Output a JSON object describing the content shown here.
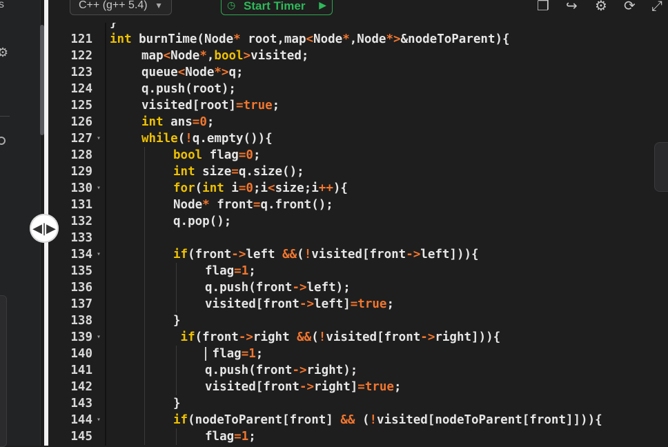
{
  "toolbar": {
    "language": "C++ (g++ 5.4)",
    "timer_label": "Start Timer",
    "left_tab_text": "s"
  },
  "colors": {
    "keyword": "#eec100",
    "operator": "#f2762e",
    "text": "#e6e6e6",
    "timer": "#2fb85a"
  },
  "icons": [
    "chevron-down-icon",
    "stopwatch-icon",
    "play-circle-icon",
    "copy-icon",
    "export-icon",
    "settings-icon",
    "reset-icon",
    "fullscreen-icon",
    "gear-icon",
    "splitter-handle-icon"
  ],
  "editor": {
    "lines": [
      {
        "n": "",
        "fold": false,
        "indent": 0,
        "tokens": [
          [
            "t",
            "}"
          ]
        ]
      },
      {
        "n": "121",
        "fold": false,
        "indent": 0,
        "tokens": [
          [
            "k",
            "int"
          ],
          [
            "t",
            " burnTime(Node"
          ],
          [
            "o",
            "*"
          ],
          [
            "t",
            " root,map"
          ],
          [
            "o",
            "<"
          ],
          [
            "t",
            "Node"
          ],
          [
            "o",
            "*"
          ],
          [
            "t",
            ",Node"
          ],
          [
            "o",
            "*>"
          ],
          [
            "t",
            "&nodeToParent){"
          ]
        ]
      },
      {
        "n": "122",
        "fold": false,
        "indent": 1,
        "tokens": [
          [
            "t",
            "map"
          ],
          [
            "o",
            "<"
          ],
          [
            "t",
            "Node"
          ],
          [
            "o",
            "*"
          ],
          [
            "t",
            ","
          ],
          [
            "k",
            "bool"
          ],
          [
            "o",
            ">"
          ],
          [
            "t",
            "visited;"
          ]
        ]
      },
      {
        "n": "123",
        "fold": false,
        "indent": 1,
        "tokens": [
          [
            "t",
            "queue"
          ],
          [
            "o",
            "<"
          ],
          [
            "t",
            "Node"
          ],
          [
            "o",
            "*>"
          ],
          [
            "t",
            "q;"
          ]
        ]
      },
      {
        "n": "124",
        "fold": false,
        "indent": 1,
        "tokens": [
          [
            "t",
            "q.push(root);"
          ]
        ]
      },
      {
        "n": "125",
        "fold": false,
        "indent": 1,
        "tokens": [
          [
            "t",
            "visited[root]"
          ],
          [
            "o",
            "="
          ],
          [
            "o",
            "true"
          ],
          [
            "t",
            ";"
          ]
        ]
      },
      {
        "n": "126",
        "fold": false,
        "indent": 1,
        "tokens": [
          [
            "k",
            "int"
          ],
          [
            "t",
            " ans"
          ],
          [
            "o",
            "="
          ],
          [
            "o",
            "0"
          ],
          [
            "t",
            ";"
          ]
        ]
      },
      {
        "n": "127",
        "fold": true,
        "indent": 1,
        "tokens": [
          [
            "k",
            "while"
          ],
          [
            "t",
            "("
          ],
          [
            "o",
            "!"
          ],
          [
            "t",
            "q.empty()){"
          ]
        ]
      },
      {
        "n": "128",
        "fold": false,
        "indent": 2,
        "tokens": [
          [
            "k",
            "bool"
          ],
          [
            "t",
            " flag"
          ],
          [
            "o",
            "="
          ],
          [
            "o",
            "0"
          ],
          [
            "t",
            ";"
          ]
        ]
      },
      {
        "n": "129",
        "fold": false,
        "indent": 2,
        "tokens": [
          [
            "k",
            "int"
          ],
          [
            "t",
            " size"
          ],
          [
            "o",
            "="
          ],
          [
            "t",
            "q.size();"
          ]
        ]
      },
      {
        "n": "130",
        "fold": true,
        "indent": 2,
        "tokens": [
          [
            "k",
            "for"
          ],
          [
            "t",
            "("
          ],
          [
            "k",
            "int"
          ],
          [
            "t",
            " i"
          ],
          [
            "o",
            "="
          ],
          [
            "o",
            "0"
          ],
          [
            "t",
            ";i"
          ],
          [
            "o",
            "<"
          ],
          [
            "t",
            "size;i"
          ],
          [
            "o",
            "++"
          ],
          [
            "t",
            "){"
          ]
        ]
      },
      {
        "n": "131",
        "fold": false,
        "indent": 2,
        "tokens": [
          [
            "t",
            "Node"
          ],
          [
            "o",
            "*"
          ],
          [
            "t",
            " front"
          ],
          [
            "o",
            "="
          ],
          [
            "t",
            "q.front();"
          ]
        ]
      },
      {
        "n": "132",
        "fold": false,
        "indent": 2,
        "tokens": [
          [
            "t",
            "q.pop();"
          ]
        ]
      },
      {
        "n": "133",
        "fold": false,
        "indent": 2,
        "tokens": []
      },
      {
        "n": "134",
        "fold": true,
        "indent": 2,
        "tokens": [
          [
            "k",
            "if"
          ],
          [
            "t",
            "(front"
          ],
          [
            "o",
            "->"
          ],
          [
            "t",
            "left "
          ],
          [
            "o",
            "&&"
          ],
          [
            "t",
            "("
          ],
          [
            "o",
            "!"
          ],
          [
            "t",
            "visited[front"
          ],
          [
            "o",
            "->"
          ],
          [
            "t",
            "left])){"
          ]
        ]
      },
      {
        "n": "135",
        "fold": false,
        "indent": 3,
        "tokens": [
          [
            "t",
            "flag"
          ],
          [
            "o",
            "="
          ],
          [
            "o",
            "1"
          ],
          [
            "t",
            ";"
          ]
        ]
      },
      {
        "n": "136",
        "fold": false,
        "indent": 3,
        "tokens": [
          [
            "t",
            "q.push(front"
          ],
          [
            "o",
            "->"
          ],
          [
            "t",
            "left);"
          ]
        ]
      },
      {
        "n": "137",
        "fold": false,
        "indent": 3,
        "tokens": [
          [
            "t",
            "visited[front"
          ],
          [
            "o",
            "->"
          ],
          [
            "t",
            "left]"
          ],
          [
            "o",
            "="
          ],
          [
            "o",
            "true"
          ],
          [
            "t",
            ";"
          ]
        ]
      },
      {
        "n": "138",
        "fold": false,
        "indent": 2,
        "tokens": [
          [
            "t",
            "}"
          ]
        ]
      },
      {
        "n": "139",
        "fold": true,
        "indent": 2,
        "tokens": [
          [
            "t",
            " "
          ],
          [
            "k",
            "if"
          ],
          [
            "t",
            "(front"
          ],
          [
            "o",
            "->"
          ],
          [
            "t",
            "right "
          ],
          [
            "o",
            "&&"
          ],
          [
            "t",
            "("
          ],
          [
            "o",
            "!"
          ],
          [
            "t",
            "visited[front"
          ],
          [
            "o",
            "->"
          ],
          [
            "t",
            "right])){"
          ]
        ]
      },
      {
        "n": "140",
        "fold": false,
        "indent": 3,
        "cursor": true,
        "tokens": [
          [
            "t",
            " flag"
          ],
          [
            "o",
            "="
          ],
          [
            "o",
            "1"
          ],
          [
            "t",
            ";"
          ]
        ]
      },
      {
        "n": "141",
        "fold": false,
        "indent": 3,
        "tokens": [
          [
            "t",
            "q.push(front"
          ],
          [
            "o",
            "->"
          ],
          [
            "t",
            "right);"
          ]
        ]
      },
      {
        "n": "142",
        "fold": false,
        "indent": 3,
        "tokens": [
          [
            "t",
            "visited[front"
          ],
          [
            "o",
            "->"
          ],
          [
            "t",
            "right]"
          ],
          [
            "o",
            "="
          ],
          [
            "o",
            "true"
          ],
          [
            "t",
            ";"
          ]
        ]
      },
      {
        "n": "143",
        "fold": false,
        "indent": 2,
        "tokens": [
          [
            "t",
            "}"
          ]
        ]
      },
      {
        "n": "144",
        "fold": true,
        "indent": 2,
        "tokens": [
          [
            "k",
            "if"
          ],
          [
            "t",
            "(nodeToParent[front] "
          ],
          [
            "o",
            "&&"
          ],
          [
            "t",
            " ("
          ],
          [
            "o",
            "!"
          ],
          [
            "t",
            "visited[nodeToParent[front]])){"
          ]
        ]
      },
      {
        "n": "145",
        "fold": false,
        "indent": 3,
        "tokens": [
          [
            "t",
            "flag"
          ],
          [
            "o",
            "="
          ],
          [
            "o",
            "1"
          ],
          [
            "t",
            ";"
          ]
        ]
      }
    ]
  }
}
